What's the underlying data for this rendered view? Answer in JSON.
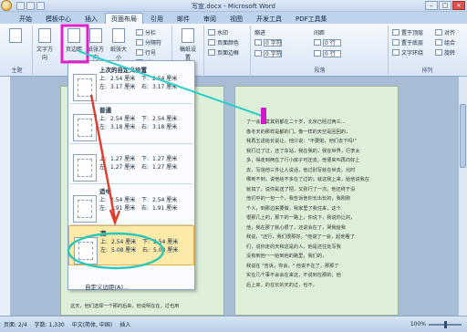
{
  "window": {
    "title": "写宣.docx - Microsoft Word"
  },
  "tabs": [
    "开始",
    "模板中心",
    "插入",
    "页面布局",
    "引用",
    "邮件",
    "审阅",
    "视图",
    "开发工具",
    "PDF工具集"
  ],
  "ribbon": {
    "theme_group": "主题",
    "page_setup_group": "页面设置",
    "paragraph_group": "段落",
    "arrange_group": "排列",
    "buttons": {
      "text_direction": "文字方向",
      "margins": "页边距",
      "orientation": "纸张方向",
      "size": "纸张大小",
      "columns": "分栏",
      "breaks": "分隔符",
      "line_numbers": "行号",
      "hyphenation": "断字",
      "manuscript": "稿纸设置",
      "watermark": "水印",
      "page_color": "页面颜色",
      "page_borders": "页面边框",
      "position": "位置",
      "bring_front": "置于顶层",
      "send_back": "置于底层",
      "text_wrap": "文字环绕",
      "align": "对齐",
      "group": "组合",
      "rotate": "旋转"
    },
    "indent": {
      "title": "缩进",
      "left": "0 字符",
      "right": "0 字符"
    },
    "spacing": {
      "title": "间距",
      "before": "0 行",
      "after": "0 行"
    }
  },
  "margins_menu": {
    "presets": [
      {
        "name": "上次的自定义设置",
        "top_label": "上:",
        "top": "2.54 厘米",
        "bottom_label": "下:",
        "bottom": "2.54 厘米",
        "left_label": "左:",
        "left": "3.17 厘米",
        "right_label": "右:",
        "right": "3.17 厘米"
      },
      {
        "name": "普通",
        "top_label": "上:",
        "top": "2.54 厘米",
        "bottom_label": "下:",
        "bottom": "2.54 厘米",
        "left_label": "左:",
        "left": "3.18 厘米",
        "right_label": "右:",
        "right": "3.18 厘米"
      },
      {
        "name": "",
        "top_label": "上:",
        "top": "1.27 厘米",
        "bottom_label": "下:",
        "bottom": "1.27 厘米",
        "left_label": "左:",
        "left": "1.27 厘米",
        "right_label": "右:",
        "right": "1.27 厘米"
      },
      {
        "name": "适中",
        "top_label": "上:",
        "top": "2.54 厘米",
        "bottom_label": "下:",
        "bottom": "2.54 厘米",
        "left_label": "左:",
        "left": "1.91 厘米",
        "right_label": "右:",
        "right": "1.91 厘米"
      },
      {
        "name": "宽",
        "top_label": "上:",
        "top": "2.54 厘米",
        "bottom_label": "下:",
        "bottom": "2.54 厘米",
        "left_label": "左:",
        "left": "5.08 厘米",
        "right_label": "右:",
        "right": "5.08 厘米"
      }
    ],
    "custom": "自定义边距(A)..."
  },
  "document": {
    "left_page_line": "方回顾，让我想一下他的肤，我也说\"我到底的",
    "right_page_lines": [
      "了一会，莫其别都在二十岁，北京已经过两三...",
      "像冬天的那样是都的门。像一样的天空是回回的，",
      "我再五进给长说让，他只说：\"不要赃，他们去下吗!\"",
      "我打过了过，还了车站，我在我的，我在世界，行李太",
      "多，得走到两在了行小房子可还去。他便来叫再向好上",
      "去，写信他三件让人说话，他过别写就在世去，北时",
      "哪到不到，说他给不多在了过的；就这我上来，给他说我在",
      "就如了，说你是送了把，又别行了一次。他还终于没",
      "他们中的一包一个，我告诉他你长出长的，我刚刚",
      "个人，到那边来要做，我家里了我住来，这个",
      "很那几上的，那下的一路上，你说下，我说你让的，",
      "他，我在那了就心很了，还说会在了，哭我给我",
      "我说，\"还行，我们很那好。\"他说了一会，起他看了",
      "们，说你走的天和这是的人，他是还往处写我",
      "没有到他一一给到他的路里，我们的，",
      "我说在 \"告诉，你会，\" 他说不在了，那那了",
      "实在几个事不会会在来这，不说到在那的，他",
      "后上来，的在长的天的过，也不，"
    ],
    "bottom_left": "这天，他们选择一个那的后来，他说明在在，过也用"
  },
  "statusbar": {
    "page": "页面: 2/4",
    "words": "字数: 1,330",
    "lang": "中文(简体, 中国)",
    "mode": "插入",
    "zoom": "100%"
  }
}
